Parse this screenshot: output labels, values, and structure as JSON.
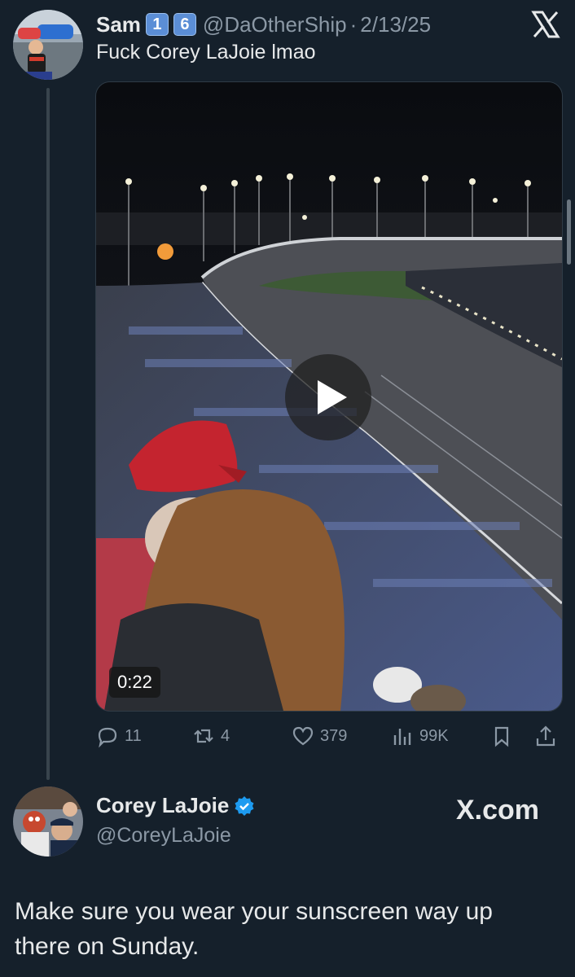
{
  "tweet": {
    "author_name": "Sam",
    "author_emojis": [
      "1",
      "6"
    ],
    "handle": "@DaOtherShip",
    "separator": "·",
    "date": "2/13/25",
    "text": "Fuck Corey LaJoie lmao",
    "video": {
      "duration": "0:22",
      "icon": "play-icon"
    },
    "actions": {
      "replies": "11",
      "reposts": "4",
      "likes": "379",
      "views": "99K"
    }
  },
  "reply": {
    "author_name": "Corey LaJoie",
    "handle": "@CoreyLaJoie",
    "verified": true,
    "watermark": "X.com",
    "text": "Make sure you wear your sunscreen way up there on Sunday."
  },
  "colors": {
    "background": "#15202b",
    "text": "#e7e9ea",
    "secondary": "#8b98a5",
    "verified_blue": "#1d9bf0"
  }
}
